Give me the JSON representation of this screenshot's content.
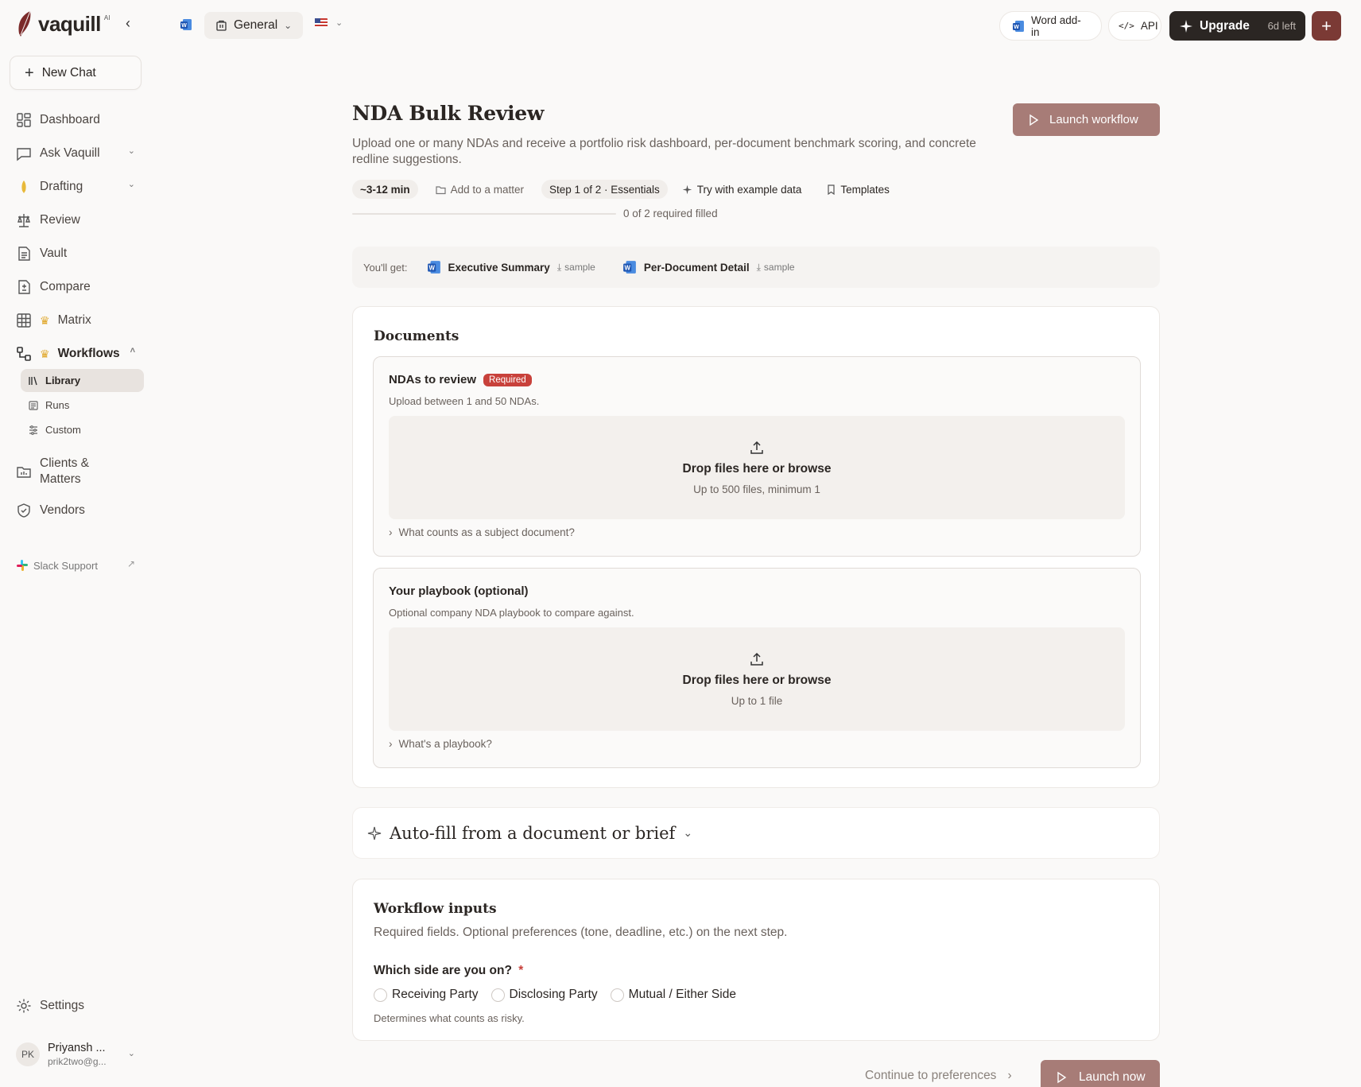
{
  "brand": {
    "name": "vaquill",
    "suffix": "AI"
  },
  "sidebar": {
    "new_chat": "New Chat",
    "items": [
      {
        "label": "Dashboard",
        "icon": "dashboard-icon"
      },
      {
        "label": "Ask Vaquill",
        "icon": "chat-icon"
      },
      {
        "label": "Drafting",
        "icon": "pen-icon"
      },
      {
        "label": "Review",
        "icon": "scale-icon"
      },
      {
        "label": "Vault",
        "icon": "file-icon"
      },
      {
        "label": "Compare",
        "icon": "compare-icon"
      },
      {
        "label": "Matrix",
        "icon": "grid-icon"
      },
      {
        "label": "Workflows",
        "icon": "workflow-icon"
      },
      {
        "label": "Clients & Matters",
        "icon": "folder-icon"
      },
      {
        "label": "Vendors",
        "icon": "shield-icon"
      }
    ],
    "workflow_sub": [
      {
        "label": "Library",
        "icon": "library-icon"
      },
      {
        "label": "Runs",
        "icon": "runs-icon"
      },
      {
        "label": "Custom",
        "icon": "sliders-icon"
      }
    ],
    "slack": "Slack Support",
    "settings": "Settings",
    "user": {
      "initials": "PK",
      "name": "Priyansh ...",
      "email": "prik2two@g..."
    }
  },
  "topbar": {
    "workspace": "General",
    "word_addin": "Word add-in",
    "api": "API",
    "upgrade": "Upgrade",
    "days_left": "6d left"
  },
  "page": {
    "title": "NDA Bulk Review",
    "description": "Upload one or many NDAs and receive a portfolio risk dashboard, per-document benchmark scoring, and concrete redline suggestions.",
    "launch_workflow": "Launch workflow",
    "meta": {
      "time": "~3-12 min",
      "add_matter": "Add to a matter",
      "step": "Step 1 of 2 · Essentials",
      "try_example": "Try with example data",
      "templates": "Templates"
    },
    "progress": {
      "label": "0 of 2 required filled",
      "fraction": 0
    },
    "yougot": {
      "label": "You'll get:",
      "outputs": [
        {
          "name": "Executive Summary",
          "sample": "sample"
        },
        {
          "name": "Per-Document Detail",
          "sample": "sample"
        }
      ]
    },
    "documents": {
      "title": "Documents",
      "ndas": {
        "title": "NDAs to review",
        "badge": "Required",
        "desc": "Upload between 1 and 50 NDAs.",
        "drop_main": "Drop files here or browse",
        "drop_sub": "Up to 500 files, minimum 1",
        "help": "What counts as a subject document?"
      },
      "playbook": {
        "title": "Your playbook (optional)",
        "desc": "Optional company NDA playbook to compare against.",
        "drop_main": "Drop files here or browse",
        "drop_sub": "Up to 1 file",
        "help": "What's a playbook?"
      }
    },
    "autofill": "Auto-fill from a document or brief",
    "inputs": {
      "title": "Workflow inputs",
      "desc": "Required fields. Optional preferences (tone, deadline, etc.) on the next step.",
      "question": "Which side are you on?",
      "required_mark": "*",
      "options": [
        "Receiving Party",
        "Disclosing Party",
        "Mutual / Either Side"
      ],
      "hint": "Determines what counts as risky."
    },
    "continue": "Continue to preferences",
    "launch_now": "Launch now"
  },
  "colors": {
    "accent": "#a77c77",
    "brand_dark": "#7b3a35",
    "required": "#c8413b",
    "crown": "#e0a72a"
  }
}
